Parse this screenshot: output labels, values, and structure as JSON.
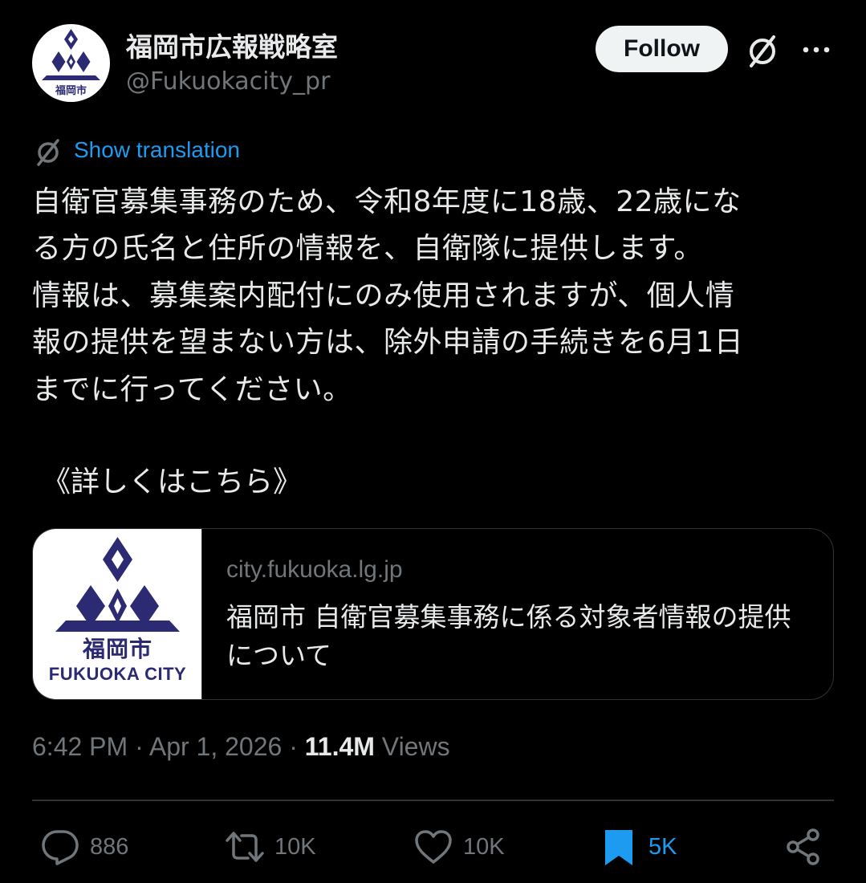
{
  "header": {
    "display_name": "福岡市広報戦略室",
    "handle": "@Fukuokacity_pr",
    "follow_label": "Follow",
    "avatar_text": "福岡市"
  },
  "translation": {
    "label": "Show translation"
  },
  "body": {
    "lines": [
      "自衛官募集事務のため、令和8年度に18歳、22歳にな",
      "る方の氏名と住所の情報を、自衛隊に提供します。",
      "情報は、募集案内配付にのみ使用されますが、個人情",
      "報の提供を望まない方は、除外申請の手続きを6月1日",
      "までに行ってください。"
    ],
    "details": "《詳しくはこちら》"
  },
  "link_card": {
    "thumb_kanji": "福岡市",
    "thumb_en": "FUKUOKA CITY",
    "domain": "city.fukuoka.lg.jp",
    "title": "福岡市 自衛官募集事務に係る対象者情報の提供について"
  },
  "meta": {
    "time": "6:42 PM",
    "separator": "·",
    "date": "Apr 1, 2026",
    "views_count": "11.4M",
    "views_label": "Views"
  },
  "actions": {
    "replies": "886",
    "reposts": "10K",
    "likes": "10K",
    "bookmarks": "5K"
  },
  "colors": {
    "background": "#000000",
    "text": "#e7e9ea",
    "secondary": "#71767b",
    "accent": "#1d9bf0",
    "border": "#2f3336",
    "logo": "#2b2a72"
  },
  "icons": [
    "grok-icon",
    "more-icon",
    "translate-icon",
    "reply-icon",
    "repost-icon",
    "like-icon",
    "bookmark-icon",
    "share-icon"
  ]
}
